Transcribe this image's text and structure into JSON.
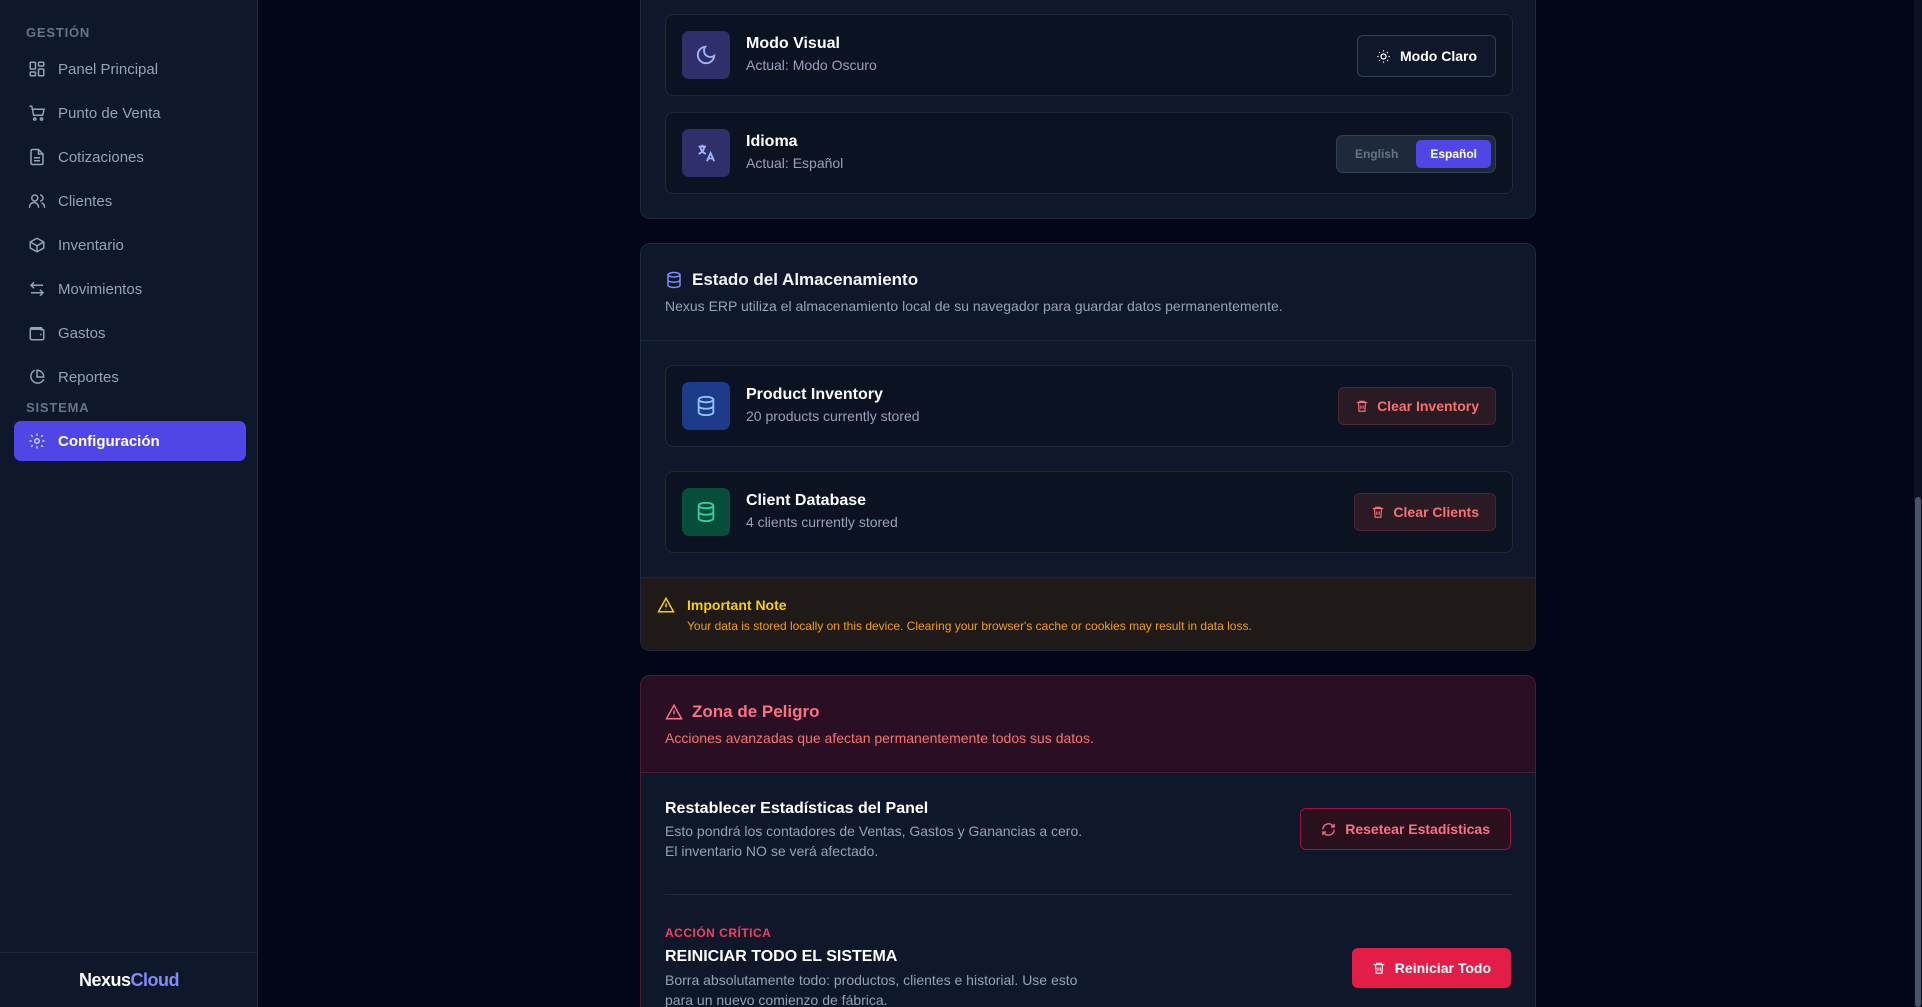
{
  "sidebar": {
    "section_management": "GESTIÓN",
    "section_system": "SISTEMA",
    "items": [
      {
        "label": "Panel Principal",
        "icon": "dashboard-icon"
      },
      {
        "label": "Punto de Venta",
        "icon": "cart-icon"
      },
      {
        "label": "Cotizaciones",
        "icon": "document-icon"
      },
      {
        "label": "Clientes",
        "icon": "users-icon"
      },
      {
        "label": "Inventario",
        "icon": "box-icon"
      },
      {
        "label": "Movimientos",
        "icon": "arrows-icon"
      },
      {
        "label": "Gastos",
        "icon": "wallet-icon"
      },
      {
        "label": "Reportes",
        "icon": "pie-chart-icon"
      }
    ],
    "settings_item": {
      "label": "Configuración",
      "icon": "gear-icon",
      "active": true
    },
    "brand": {
      "part1": "Nexus",
      "part2": "Cloud"
    }
  },
  "appearance": {
    "visual_mode": {
      "title": "Modo Visual",
      "current": "Actual: Modo Oscuro",
      "button": "Modo Claro"
    },
    "language": {
      "title": "Idioma",
      "current": "Actual: Español",
      "options": [
        "English",
        "Español"
      ],
      "selected": "Español"
    }
  },
  "storage": {
    "title": "Estado del Almacenamiento",
    "description": "Nexus ERP utiliza el almacenamiento local de su navegador para guardar datos permanentemente.",
    "product_inventory": {
      "title": "Product Inventory",
      "count_text": "20 products currently stored",
      "button": "Clear Inventory"
    },
    "client_database": {
      "title": "Client Database",
      "count_text": "4 clients currently stored",
      "button": "Clear Clients"
    },
    "note": {
      "title": "Important Note",
      "text": "Your data is stored locally on this device. Clearing your browser's cache or cookies may result in data loss."
    }
  },
  "danger_zone": {
    "title": "Zona de Peligro",
    "description": "Acciones avanzadas que afectan permanentemente todos sus datos.",
    "reset_stats": {
      "title": "Restablecer Estadísticas del Panel",
      "line1": "Esto pondrá los contadores de Ventas, Gastos y Ganancias a cero.",
      "line2": "El inventario NO se verá afectado.",
      "button": "Resetear Estadísticas"
    },
    "critical": {
      "label": "ACCIÓN CRÍTICA",
      "title": "REINICIAR TODO EL SISTEMA",
      "line1": "Borra absolutamente todo: productos, clientes e historial. Use esto",
      "line2": "para un nuevo comienzo de fábrica.",
      "button": "Reiniciar Todo"
    }
  },
  "colors": {
    "accent": "#4f46e5",
    "danger": "#e11d48",
    "warning": "#facc15",
    "background": "#020617",
    "panel": "#0f172a"
  }
}
